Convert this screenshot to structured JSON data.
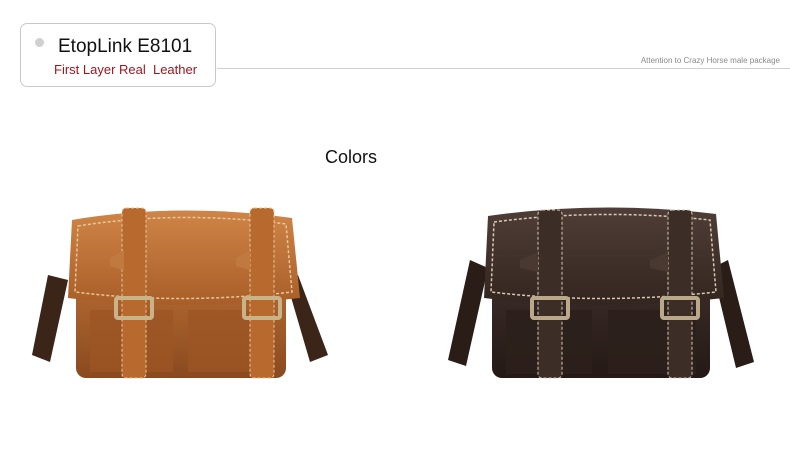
{
  "header": {
    "model_name": "EtopLink E8101",
    "subtitle": "First Layer Real  Leather",
    "tagline": "Attention to Crazy Horse male package"
  },
  "section": {
    "title": "Colors"
  },
  "products": [
    {
      "color_name": "tan-brown",
      "leather": "#b5652a",
      "stitch": "#e8c59a"
    },
    {
      "color_name": "dark-coffee",
      "leather": "#3a2a24",
      "stitch": "#d8c8b4"
    }
  ]
}
